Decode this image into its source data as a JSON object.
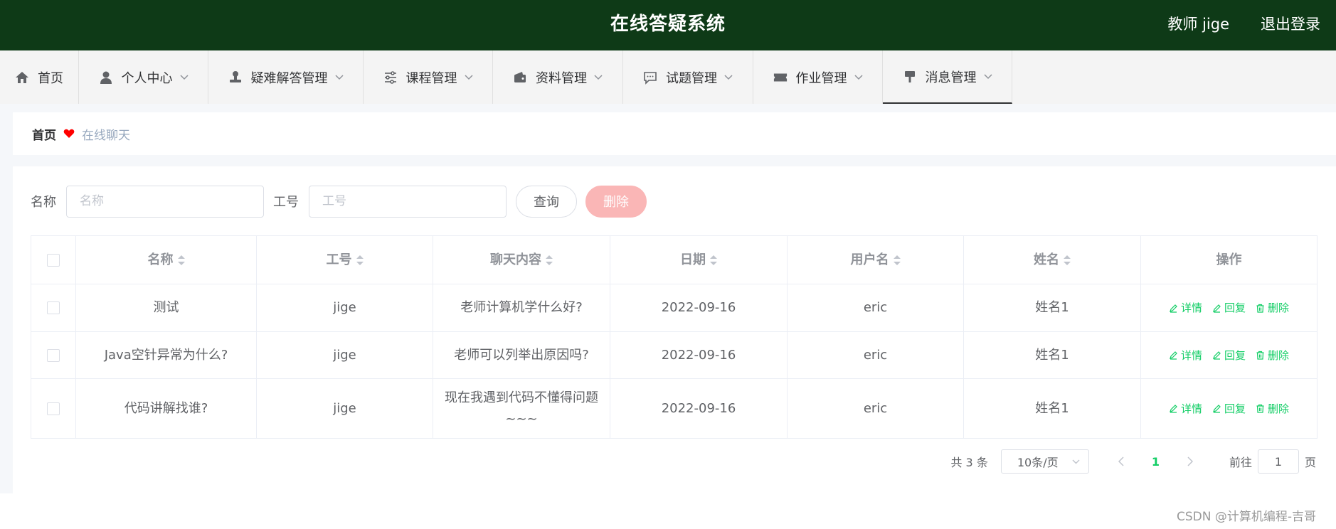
{
  "header": {
    "title": "在线答疑系统",
    "user": "教师 jige",
    "logout": "退出登录"
  },
  "menu": [
    {
      "label": "首页",
      "icon": "home-icon"
    },
    {
      "label": "个人中心",
      "icon": "user-icon"
    },
    {
      "label": "疑难解答管理",
      "icon": "stamp-icon"
    },
    {
      "label": "课程管理",
      "icon": "sliders-icon"
    },
    {
      "label": "资料管理",
      "icon": "wallet-icon"
    },
    {
      "label": "试题管理",
      "icon": "chat-icon"
    },
    {
      "label": "作业管理",
      "icon": "ticket-icon"
    },
    {
      "label": "消息管理",
      "icon": "brush-icon"
    }
  ],
  "breadcrumb": {
    "home": "首页",
    "current": "在线聊天"
  },
  "search": {
    "name_label": "名称",
    "name_placeholder": "名称",
    "id_label": "工号",
    "id_placeholder": "工号",
    "query_button": "查询",
    "delete_button": "删除"
  },
  "table": {
    "columns": [
      "名称",
      "工号",
      "聊天内容",
      "日期",
      "用户名",
      "姓名",
      "操作"
    ],
    "rows": [
      {
        "name": "测试",
        "id": "jige",
        "content": "老师计算机学什么好?",
        "date": "2022-09-16",
        "username": "eric",
        "realname": "姓名1"
      },
      {
        "name": "Java空针异常为什么?",
        "id": "jige",
        "content": "老师可以列举出原因吗?",
        "date": "2022-09-16",
        "username": "eric",
        "realname": "姓名1"
      },
      {
        "name": "代码讲解找谁?",
        "id": "jige",
        "content": "现在我遇到代码不懂得问题~~~",
        "date": "2022-09-16",
        "username": "eric",
        "realname": "姓名1"
      }
    ],
    "actions": {
      "detail": "详情",
      "reply": "回复",
      "delete": "删除"
    }
  },
  "pagination": {
    "total": "共 3 条",
    "page_size": "10条/页",
    "current_page": "1",
    "goto_label": "前往",
    "goto_value": "1",
    "page_unit": "页"
  },
  "watermark": "CSDN @计算机编程-吉哥",
  "colors": {
    "header_bg": "#0e3a17",
    "accent": "#13ce66",
    "danger_light": "#fab6b6"
  }
}
